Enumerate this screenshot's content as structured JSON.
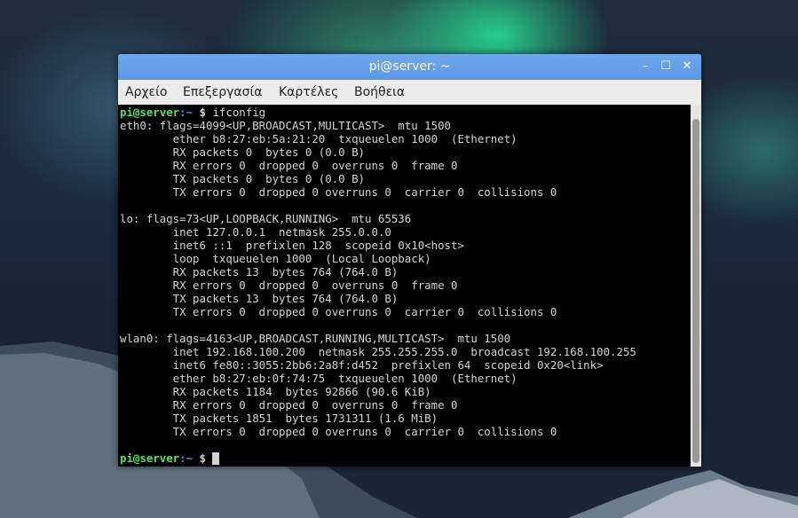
{
  "window": {
    "title": "pi@server: ~",
    "buttons": {
      "minimize": "–",
      "maximize": "☐",
      "close": "✕"
    }
  },
  "menu": [
    "Αρχείο",
    "Επεξεργασία",
    "Καρτέλες",
    "Βοήθεια"
  ],
  "prompt": {
    "user_host": "pi@server",
    "path": ":~",
    "symbol": " $ "
  },
  "terminal": {
    "command": "ifconfig",
    "lines": [
      "eth0: flags=4099<UP,BROADCAST,MULTICAST>  mtu 1500",
      "        ether b8:27:eb:5a:21:20  txqueuelen 1000  (Ethernet)",
      "        RX packets 0  bytes 0 (0.0 B)",
      "        RX errors 0  dropped 0  overruns 0  frame 0",
      "        TX packets 0  bytes 0 (0.0 B)",
      "        TX errors 0  dropped 0 overruns 0  carrier 0  collisions 0",
      "",
      "lo: flags=73<UP,LOOPBACK,RUNNING>  mtu 65536",
      "        inet 127.0.0.1  netmask 255.0.0.0",
      "        inet6 ::1  prefixlen 128  scopeid 0x10<host>",
      "        loop  txqueuelen 1000  (Local Loopback)",
      "        RX packets 13  bytes 764 (764.0 B)",
      "        RX errors 0  dropped 0  overruns 0  frame 0",
      "        TX packets 13  bytes 764 (764.0 B)",
      "        TX errors 0  dropped 0 overruns 0  carrier 0  collisions 0",
      "",
      "wlan0: flags=4163<UP,BROADCAST,RUNNING,MULTICAST>  mtu 1500",
      "        inet 192.168.100.200  netmask 255.255.255.0  broadcast 192.168.100.255",
      "        inet6 fe80::3055:2bb6:2a8f:d452  prefixlen 64  scopeid 0x20<link>",
      "        ether b8:27:eb:0f:74:75  txqueuelen 1000  (Ethernet)",
      "        RX packets 1184  bytes 92866 (90.6 KiB)",
      "        RX errors 0  dropped 0  overruns 0  frame 0",
      "        TX packets 1851  bytes 1731311 (1.6 MiB)",
      "        TX errors 0  dropped 0 overruns 0  carrier 0  collisions 0",
      ""
    ]
  },
  "colors": {
    "titlebar": "#5b97e3",
    "terminal_bg": "#000000",
    "terminal_fg": "#d3d3d3",
    "prompt_user": "#57e25c",
    "prompt_path": "#6b7cff"
  }
}
